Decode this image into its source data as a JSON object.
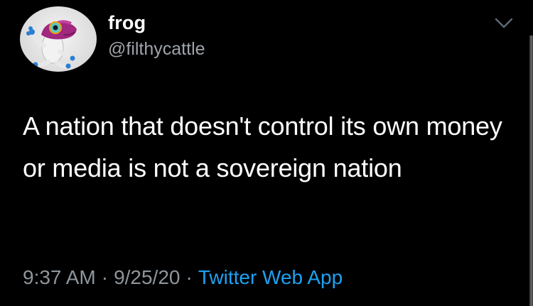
{
  "tweet": {
    "display_name": "frog",
    "handle": "@filthycattle",
    "text": "A nation that doesn't control its own money or media is not a sovereign nation",
    "time": "9:37 AM",
    "separator": "·",
    "date": "9/25/20",
    "source": "Twitter Web App",
    "avatar_icon": "tree-frog-avatar",
    "caret_icon": "chevron-down-icon"
  },
  "colors": {
    "background": "#000000",
    "text": "#ffffff",
    "secondary_text": "#9ea4aa",
    "link": "#1da1f2"
  }
}
